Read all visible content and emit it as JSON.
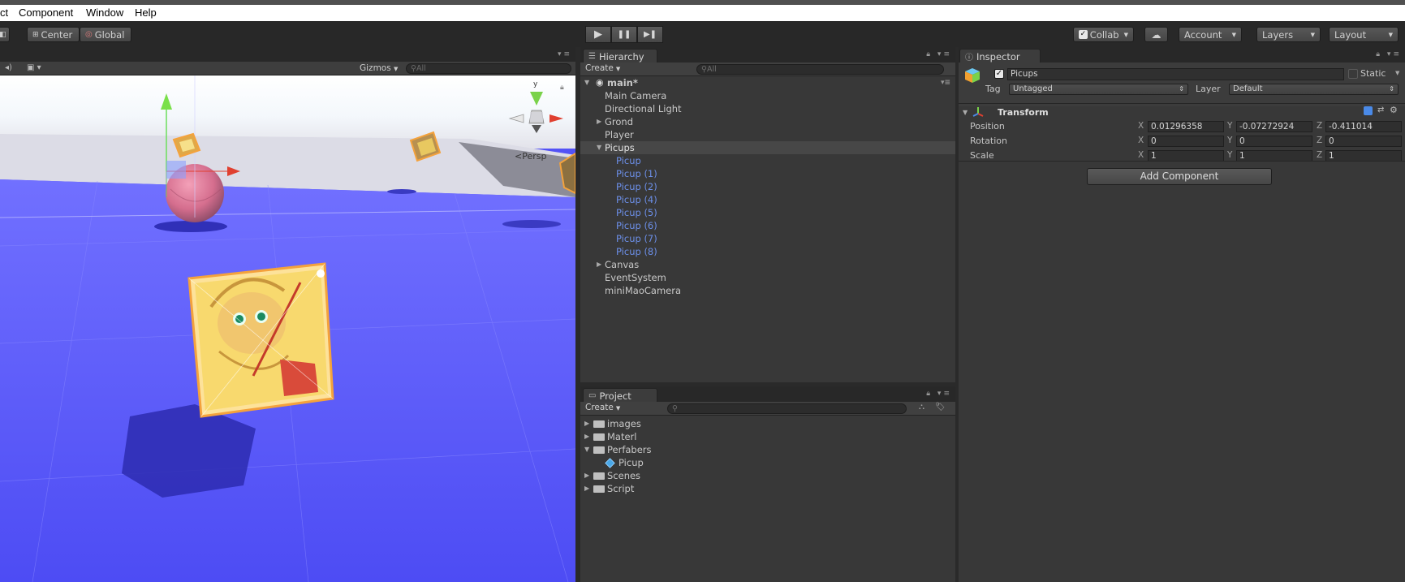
{
  "menu": {
    "items": [
      "ct",
      "Component",
      "Window",
      "Help"
    ]
  },
  "toolbar": {
    "pivot_label": "Center",
    "space_label": "Global",
    "play": "▶",
    "pause": "❚❚",
    "step": "▶❚",
    "collab_label": "Collab",
    "account_label": "Account",
    "layers_label": "Layers",
    "layout_label": "Layout"
  },
  "scene": {
    "gizmos_label": "Gizmos",
    "search_placeholder": "All",
    "persp_label": "Persp",
    "axis_y": "y"
  },
  "hierarchy": {
    "tab_label": "Hierarchy",
    "create_label": "Create",
    "search_placeholder": "All",
    "scene_name": "main*",
    "items": [
      {
        "label": "Main Camera"
      },
      {
        "label": "Directional Light"
      },
      {
        "label": "Grond"
      },
      {
        "label": "Player"
      },
      {
        "label": "Picups"
      },
      {
        "label": "Picup"
      },
      {
        "label": "Picup (1)"
      },
      {
        "label": "Picup (2)"
      },
      {
        "label": "Picup (4)"
      },
      {
        "label": "Picup (5)"
      },
      {
        "label": "Picup (6)"
      },
      {
        "label": "Picup (7)"
      },
      {
        "label": "Picup (8)"
      },
      {
        "label": "Canvas"
      },
      {
        "label": "EventSystem"
      },
      {
        "label": "miniMaoCamera"
      }
    ]
  },
  "project": {
    "tab_label": "Project",
    "create_label": "Create",
    "items": [
      {
        "label": "images"
      },
      {
        "label": "Materl"
      },
      {
        "label": "Perfabers"
      },
      {
        "label": "Picup"
      },
      {
        "label": "Scenes"
      },
      {
        "label": "Script"
      }
    ]
  },
  "inspector": {
    "tab_label": "Inspector",
    "object_name": "Picups",
    "active": true,
    "static_label": "Static",
    "tag_label": "Tag",
    "tag_value": "Untagged",
    "layer_label": "Layer",
    "layer_value": "Default",
    "component_title": "Transform",
    "rows": [
      {
        "label": "Position",
        "x": "0.01296358",
        "y": "-0.07272924",
        "z": "-0.411014"
      },
      {
        "label": "Rotation",
        "x": "0",
        "y": "0",
        "z": "0"
      },
      {
        "label": "Scale",
        "x": "1",
        "y": "1",
        "z": "1"
      }
    ],
    "axis_x": "X",
    "axis_y": "Y",
    "axis_z": "Z",
    "add_component_label": "Add Component"
  },
  "colors": {
    "selection_blue": "#6c8fe8",
    "ground_blue": "#5352f6",
    "pickup_orange": "#f4a23c",
    "ball_pink": "#d9708f"
  }
}
